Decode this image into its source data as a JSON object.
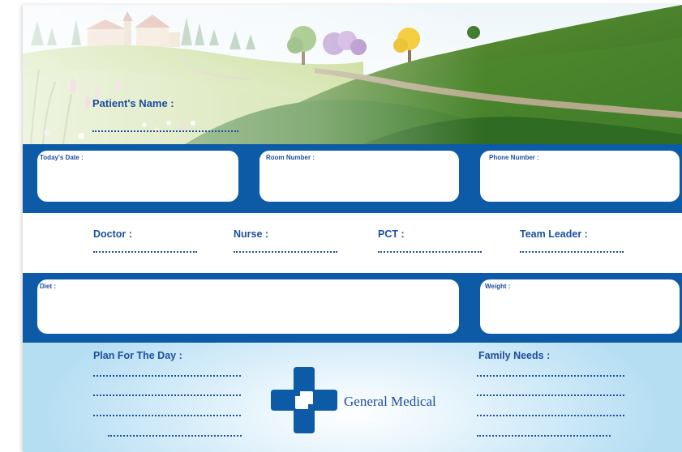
{
  "header": {
    "patient_name_label": "Patient's Name :"
  },
  "info_cards": [
    {
      "label": "Today's Date :"
    },
    {
      "label": "Room Number :"
    },
    {
      "label": "Phone Number :"
    }
  ],
  "staff": [
    {
      "label": "Doctor :"
    },
    {
      "label": "Nurse :"
    },
    {
      "label": "PCT :"
    },
    {
      "label": "Team Leader :"
    }
  ],
  "diet_card": {
    "label": "Diet :"
  },
  "weight_card": {
    "label": "Weight :"
  },
  "plan": {
    "label": "Plan For The Day :"
  },
  "family": {
    "label": "Family Needs :"
  },
  "logo": {
    "text": "General Medical",
    "color": "#1d4fa0"
  },
  "colors": {
    "band": "#0d5aa7",
    "text": "#1d4fa0",
    "bottom": "#b6def3"
  }
}
